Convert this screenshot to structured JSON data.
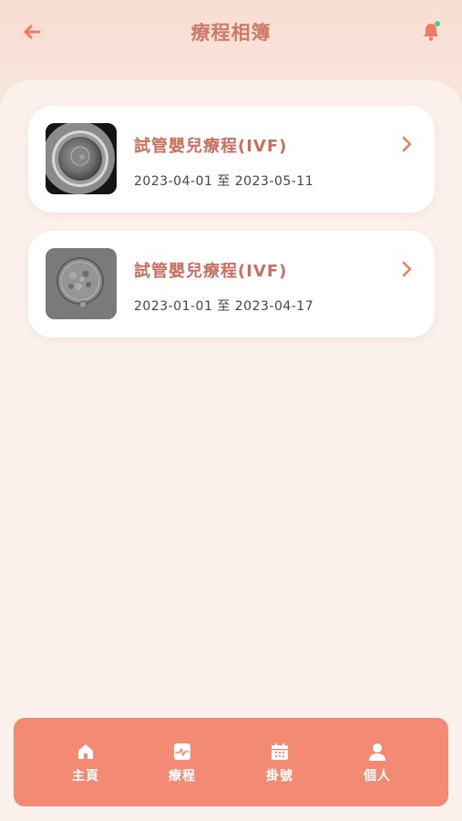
{
  "header": {
    "title": "療程相簿",
    "back_icon": "arrow-left-icon",
    "bell_icon": "bell-icon",
    "notification_dot_color": "#3fcf9b"
  },
  "albums": [
    {
      "title": "試管嬰兒療程(IVF)",
      "date_range": "2023-04-01 至 2023-05-11",
      "thumbnail": "egg-cell-image"
    },
    {
      "title": "試管嬰兒療程(IVF)",
      "date_range": "2023-01-01 至 2023-04-17",
      "thumbnail": "embryo-image"
    }
  ],
  "nav": {
    "items": [
      {
        "label": "主頁",
        "icon": "home-icon"
      },
      {
        "label": "療程",
        "icon": "treatment-icon"
      },
      {
        "label": "掛號",
        "icon": "calendar-icon"
      },
      {
        "label": "個人",
        "icon": "user-icon"
      }
    ],
    "active": "療程"
  },
  "colors": {
    "accent": "#f38b74",
    "title": "#cf7a66",
    "card_title": "#c8705f"
  }
}
